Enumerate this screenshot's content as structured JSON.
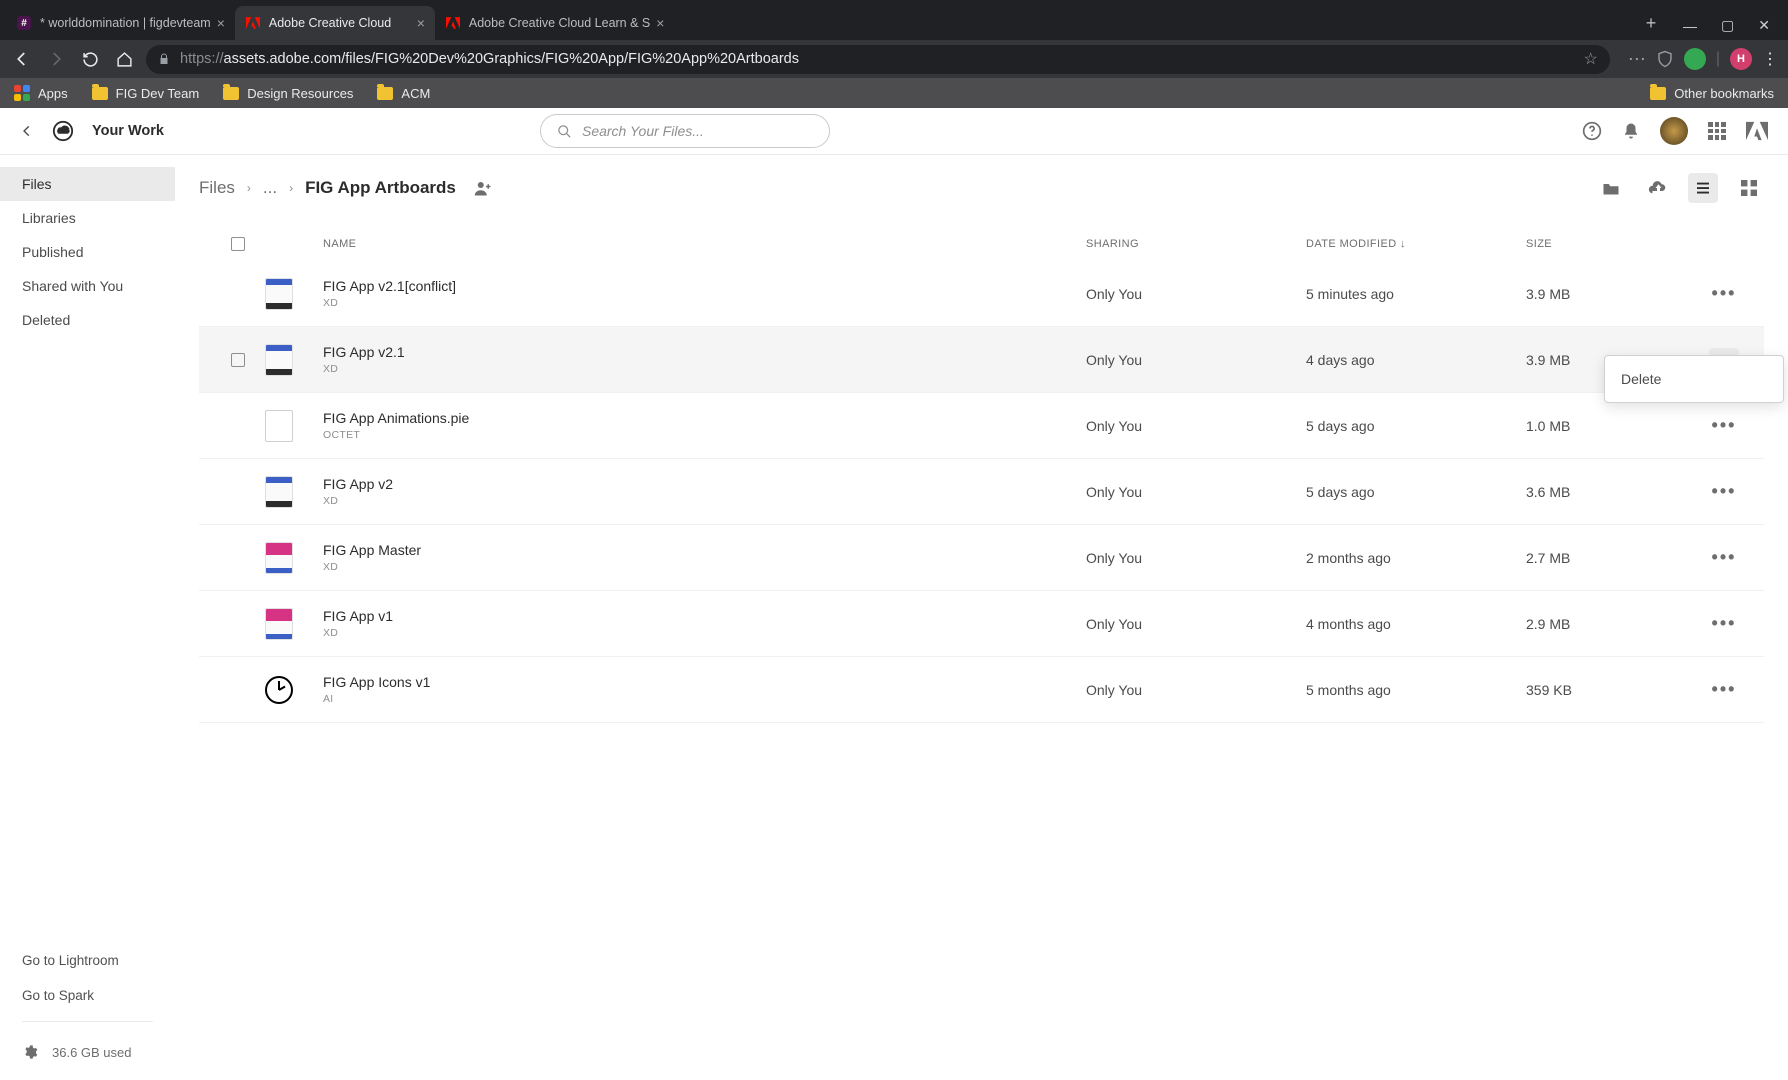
{
  "browser": {
    "tabs": [
      {
        "title": "* worlddomination | figdevteam",
        "active": false,
        "favicon": "slack"
      },
      {
        "title": "Adobe Creative Cloud",
        "active": true,
        "favicon": "adobe"
      },
      {
        "title": "Adobe Creative Cloud Learn & S",
        "active": false,
        "favicon": "adobe"
      }
    ],
    "url_scheme": "https://",
    "url_rest": "assets.adobe.com/files/FIG%20Dev%20Graphics/FIG%20App/FIG%20App%20Artboards",
    "avatar_letter": "H"
  },
  "bookmarks": {
    "items": [
      "Apps",
      "FIG Dev Team",
      "Design Resources",
      "ACM"
    ],
    "other": "Other bookmarks"
  },
  "header": {
    "title": "Your Work",
    "search_placeholder": "Search Your Files..."
  },
  "sidebar": {
    "items": [
      "Files",
      "Libraries",
      "Published",
      "Shared with You",
      "Deleted"
    ],
    "active_index": 0,
    "bottom_links": [
      "Go to Lightroom",
      "Go to Spark"
    ],
    "storage": "36.6 GB used"
  },
  "breadcrumbs": {
    "root": "Files",
    "mid": "...",
    "current": "FIG App Artboards"
  },
  "columns": {
    "name": "NAME",
    "sharing": "SHARING",
    "date": "DATE MODIFIED",
    "size": "SIZE"
  },
  "context_menu": {
    "items": [
      "Delete"
    ]
  },
  "files": [
    {
      "name": "FIG App v2.1[conflict]",
      "type": "XD",
      "sharing": "Only You",
      "date": "5 minutes ago",
      "size": "3.9 MB",
      "hover": false,
      "thumb": "xd-blue"
    },
    {
      "name": "FIG App v2.1",
      "type": "XD",
      "sharing": "Only You",
      "date": "4 days ago",
      "size": "3.9 MB",
      "hover": true,
      "thumb": "xd-blue"
    },
    {
      "name": "FIG App Animations.pie",
      "type": "OCTET",
      "sharing": "Only You",
      "date": "5 days ago",
      "size": "1.0 MB",
      "hover": false,
      "thumb": "blank"
    },
    {
      "name": "FIG App v2",
      "type": "XD",
      "sharing": "Only You",
      "date": "5 days ago",
      "size": "3.6 MB",
      "hover": false,
      "thumb": "xd-blue"
    },
    {
      "name": "FIG App Master",
      "type": "XD",
      "sharing": "Only You",
      "date": "2 months ago",
      "size": "2.7 MB",
      "hover": false,
      "thumb": "xd-pink"
    },
    {
      "name": "FIG App v1",
      "type": "XD",
      "sharing": "Only You",
      "date": "4 months ago",
      "size": "2.9 MB",
      "hover": false,
      "thumb": "xd-pink"
    },
    {
      "name": "FIG App Icons v1",
      "type": "AI",
      "sharing": "Only You",
      "date": "5 months ago",
      "size": "359 KB",
      "hover": false,
      "thumb": "clock"
    }
  ]
}
